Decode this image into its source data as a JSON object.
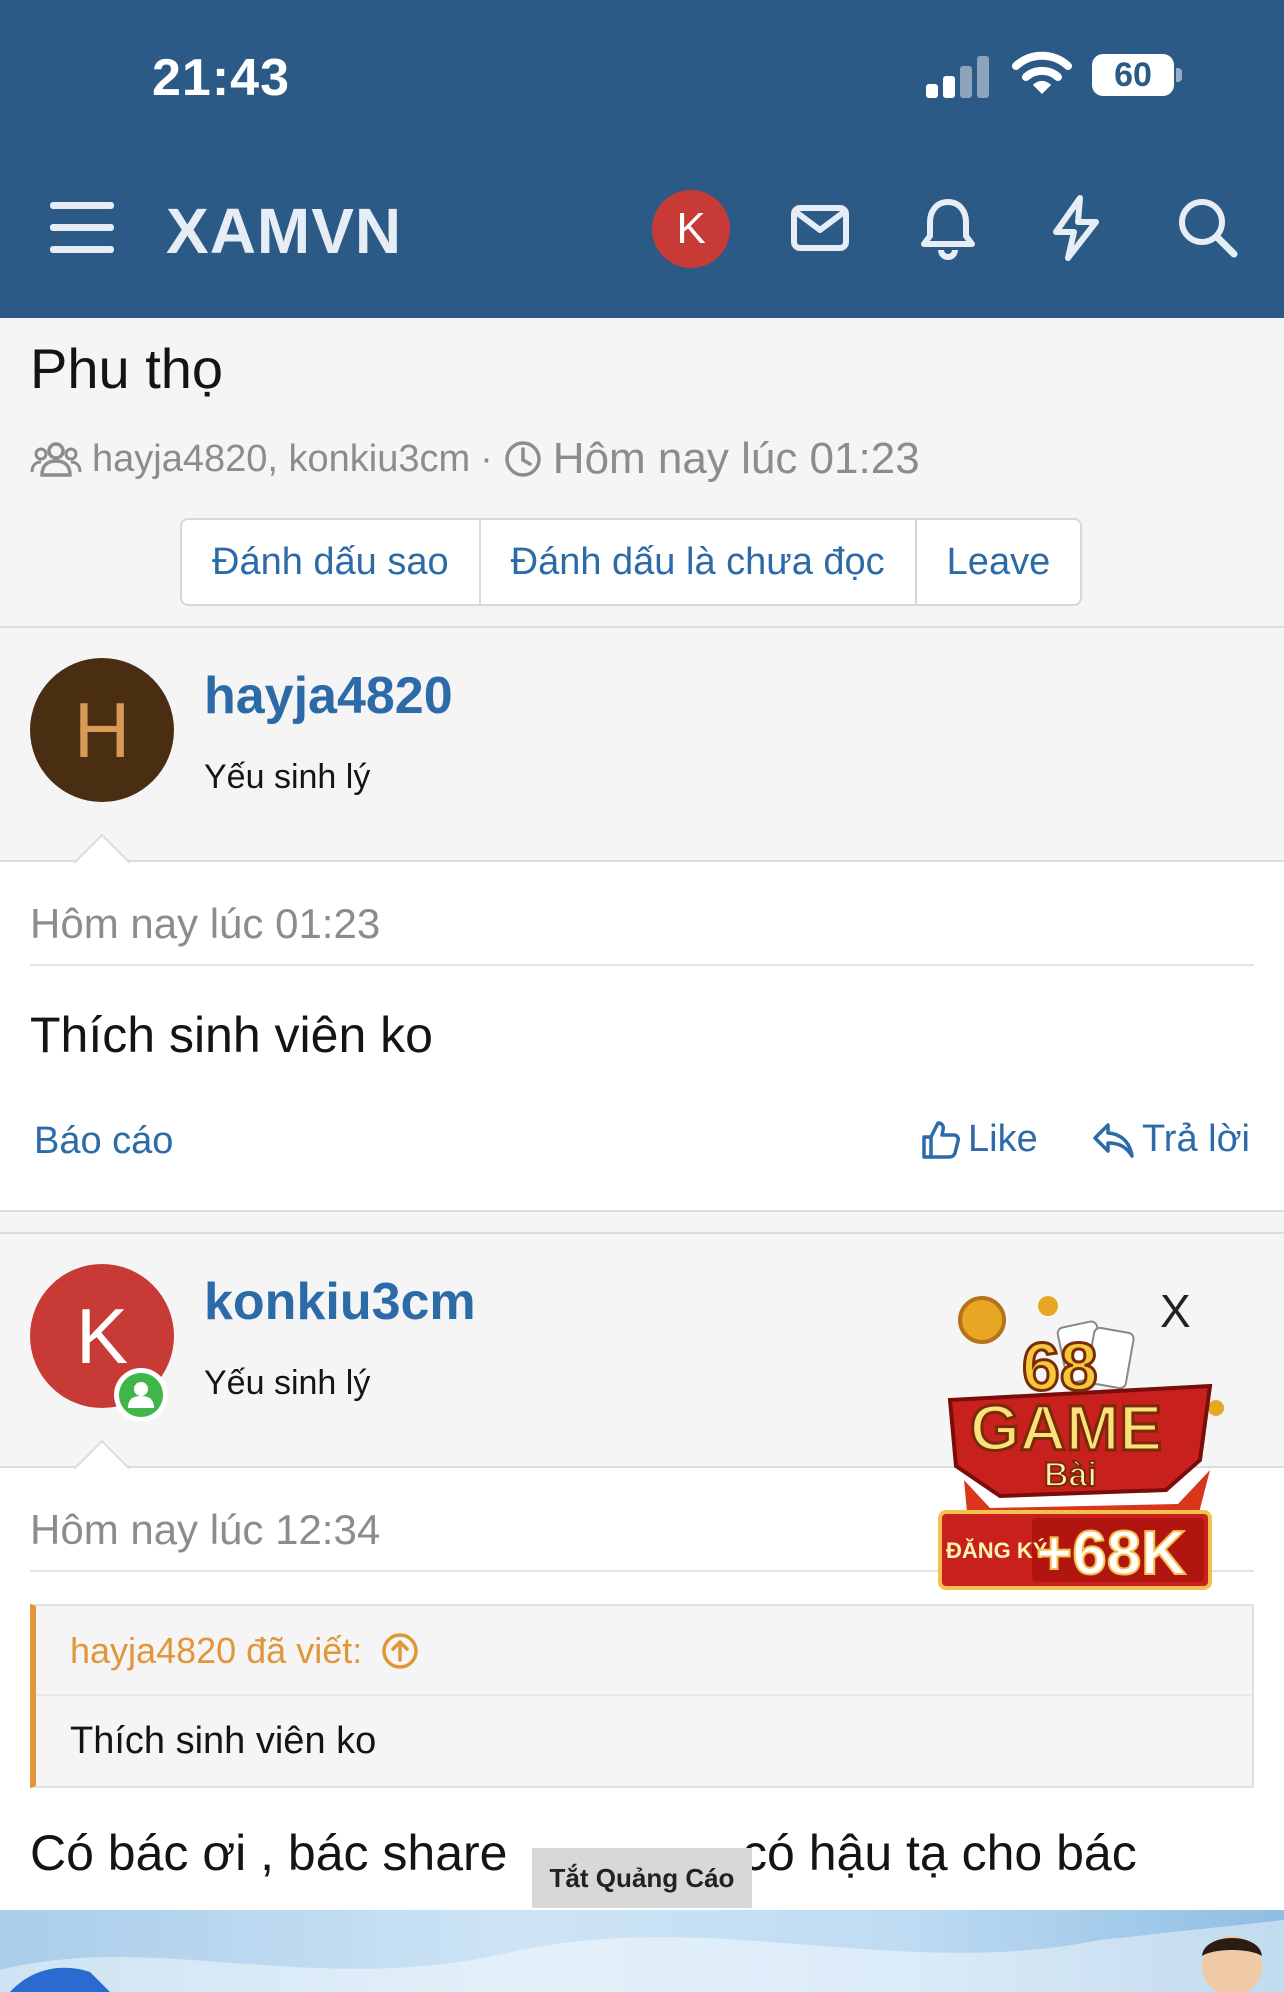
{
  "status_bar": {
    "time": "21:43",
    "battery": "60"
  },
  "header": {
    "brand": "XAMVN",
    "user_initial": "K"
  },
  "thread": {
    "title": "Phu thọ",
    "participants": "hayja4820, konkiu3cm",
    "separator": "·",
    "time": "Hôm nay lúc 01:23",
    "buttons": [
      "Đánh dấu sao",
      "Đánh dấu là chưa đọc",
      "Leave"
    ]
  },
  "posts": [
    {
      "initial": "H",
      "username": "hayja4820",
      "user_title": "Yếu sinh lý",
      "time": "Hôm nay lúc 01:23",
      "body": "Thích sinh viên ko",
      "report": "Báo cáo",
      "like": "Like",
      "reply": "Trả lời"
    },
    {
      "initial": "K",
      "username": "konkiu3cm",
      "user_title": "Yếu sinh lý",
      "time": "Hôm nay lúc 12:34",
      "quote_author": "hayja4820 đã viết:",
      "quote_body": "Thích sinh viên ko",
      "body_left": "Có bác ơi , bác share",
      "body_right": "có hậu tạ cho bác"
    }
  ],
  "ads": {
    "close": "X",
    "game_number": "68",
    "game_word": "GAME",
    "game_sub": "Bài",
    "register": "ĐĂNG KÝ",
    "bonus": "+68K",
    "turn_off": "Tắt Quảng Cáo"
  },
  "colors": {
    "header": "#2c5a86",
    "link": "#2c6aa8",
    "quote_accent": "#e2963a",
    "avatar_h": "#4a2e12",
    "avatar_k": "#c83a35"
  }
}
